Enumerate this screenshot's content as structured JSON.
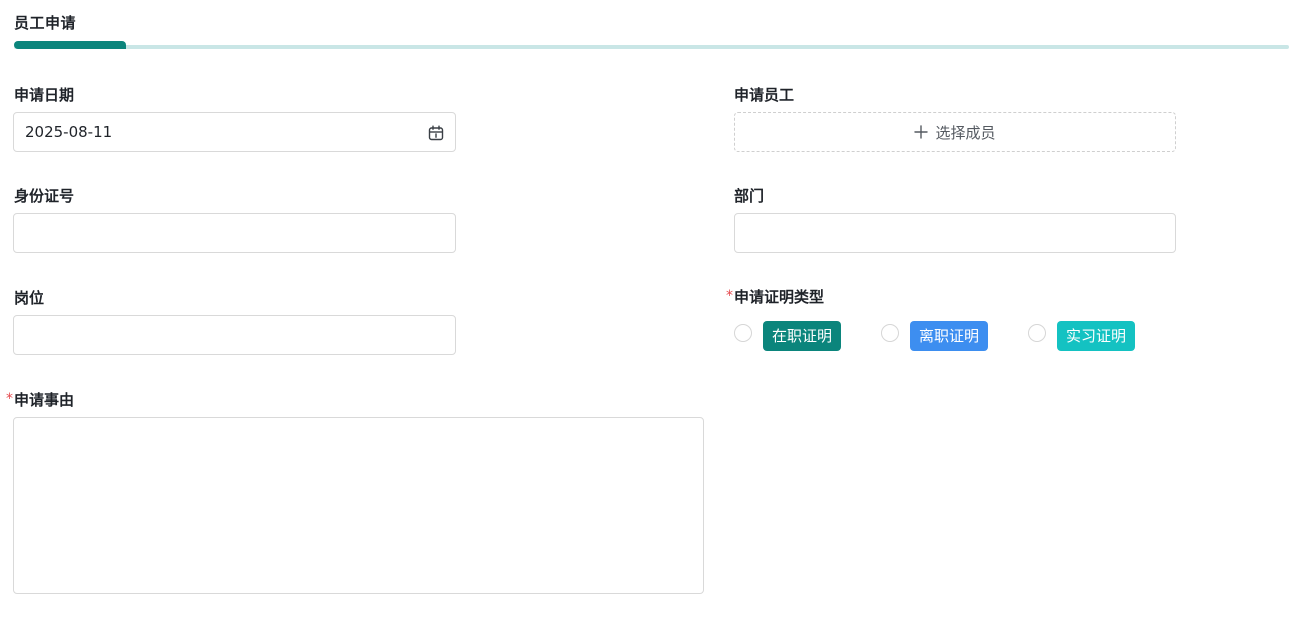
{
  "section": {
    "title": "员工申请"
  },
  "fields": {
    "apply_date": {
      "label": "申请日期",
      "value": "2025-08-11"
    },
    "apply_employee": {
      "label": "申请员工",
      "button_label": "选择成员"
    },
    "id_number": {
      "label": "身份证号",
      "value": ""
    },
    "department": {
      "label": "部门",
      "value": ""
    },
    "position": {
      "label": "岗位",
      "value": ""
    },
    "certificate_type": {
      "label": "申请证明类型",
      "required": "*",
      "options": [
        {
          "label": "在职证明",
          "color": "#0b857c",
          "selected": false
        },
        {
          "label": "离职证明",
          "color": "#3d8ef0",
          "selected": false
        },
        {
          "label": "实习证明",
          "color": "#14c2c2",
          "selected": false
        }
      ]
    },
    "reason": {
      "label": "申请事由",
      "required": "*",
      "value": ""
    }
  },
  "colors": {
    "accent": "#0b857c",
    "accent_track": "#c9e6e6",
    "required": "#e5484d"
  },
  "icons": {
    "date": "calendar-icon",
    "add": "plus-icon"
  }
}
